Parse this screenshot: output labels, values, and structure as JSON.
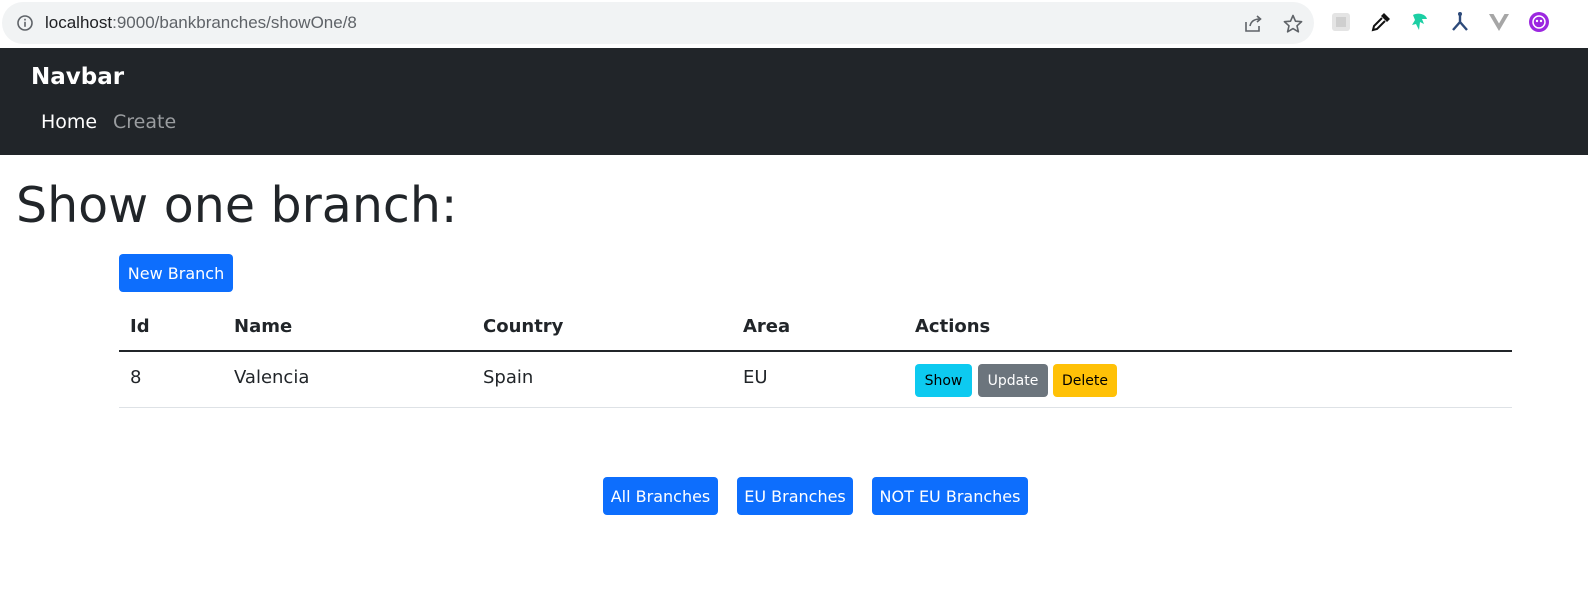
{
  "browser": {
    "url_host": "localhost",
    "url_path": ":9000/bankbranches/showOne/8",
    "icons": [
      "info-icon",
      "share-icon",
      "star-icon",
      "extension-icon",
      "eyedropper-icon",
      "dragon-extension-icon",
      "branch-extension-icon",
      "vue-devtools-icon",
      "profile-avatar-icon"
    ]
  },
  "navbar": {
    "brand": "Navbar",
    "links": [
      {
        "label": "Home",
        "active": true
      },
      {
        "label": "Create",
        "active": false
      }
    ]
  },
  "page": {
    "title": "Show one branch:",
    "new_button": "New Branch"
  },
  "table": {
    "headers": [
      "Id",
      "Name",
      "Country",
      "Area",
      "Actions"
    ],
    "rows": [
      {
        "id": "8",
        "name": "Valencia",
        "country": "Spain",
        "area": "EU"
      }
    ],
    "actions": {
      "show": "Show",
      "update": "Update",
      "delete": "Delete"
    }
  },
  "filters": {
    "all": "All Branches",
    "eu": "EU Branches",
    "not_eu": "NOT EU Branches"
  },
  "colors": {
    "navbar_bg": "#212529",
    "primary": "#0d6efd",
    "info": "#0dcaf0",
    "secondary": "#6c757d",
    "warning": "#ffc107"
  }
}
